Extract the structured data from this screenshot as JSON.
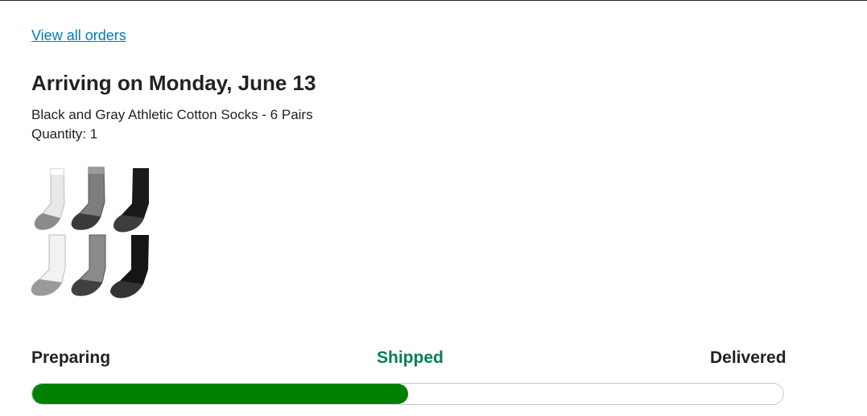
{
  "nav": {
    "back_link": "View all orders"
  },
  "order": {
    "title": "Arriving on Monday, June 13",
    "product_name": "Black and Gray Athletic Cotton Socks - 6 Pairs",
    "quantity": "Quantity: 1"
  },
  "tracking": {
    "steps": [
      {
        "label": "Preparing",
        "color": "#222222"
      },
      {
        "label": "Shipped",
        "color": "#067e56"
      },
      {
        "label": "Delivered",
        "color": "#222222"
      }
    ],
    "progress_fraction": 0.5,
    "fill_color": "#008000"
  },
  "colors": {
    "link": "#017cb6",
    "text": "#222222"
  }
}
